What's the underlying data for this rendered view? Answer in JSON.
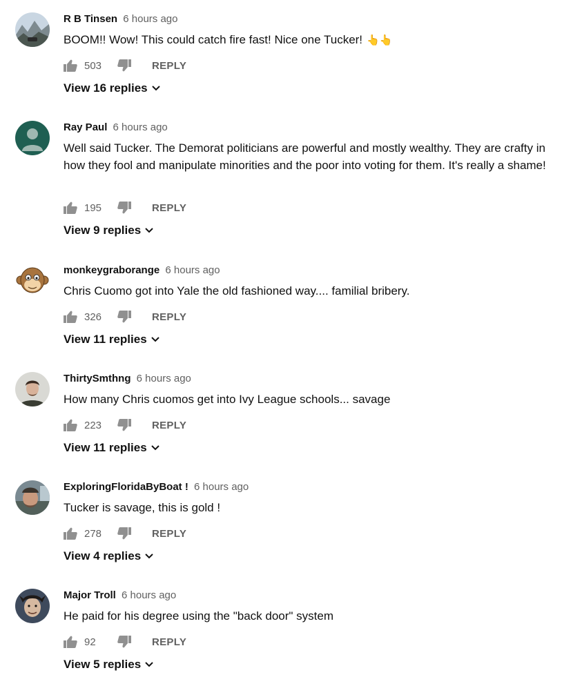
{
  "comments": [
    {
      "author": "R B Tinsen",
      "time": "6 hours ago",
      "text": "BOOM!!  Wow!  This could catch fire fast!   Nice one Tucker!",
      "emoji": "👆👆",
      "likes": "503",
      "reply_label": "REPLY",
      "view_replies": "View 16 replies",
      "avatar_icon": "mountain-landscape-avatar"
    },
    {
      "author": "Ray Paul",
      "time": "6 hours ago",
      "text": "Well said Tucker.  The Demorat politicians are powerful and mostly wealthy.  They are crafty in how they fool and manipulate minorities and the poor into voting for them.  It's really a shame!",
      "likes": "195",
      "reply_label": "REPLY",
      "view_replies": "View 9 replies",
      "avatar_icon": "default-user-avatar"
    },
    {
      "author": "monkeygraborange",
      "time": "6 hours ago",
      "text": "Chris Cuomo got into Yale the old fashioned way.... familial bribery.",
      "likes": "326",
      "reply_label": "REPLY",
      "view_replies": "View 11 replies",
      "avatar_icon": "monkey-avatar"
    },
    {
      "author": "ThirtySmthng",
      "time": "6 hours ago",
      "text": "How many Chris cuomos get into Ivy League schools... savage",
      "likes": "223",
      "reply_label": "REPLY",
      "view_replies": "View 11 replies",
      "avatar_icon": "person-photo-avatar"
    },
    {
      "author": "ExploringFloridaByBoat !",
      "time": "6 hours ago",
      "text": "Tucker is savage, this is gold !",
      "likes": "278",
      "reply_label": "REPLY",
      "view_replies": "View 4 replies",
      "avatar_icon": "person-photo-avatar"
    },
    {
      "author": "Major Troll",
      "time": "6 hours ago",
      "text": "He paid for his degree using the \"back door\" system",
      "likes": "92",
      "reply_label": "REPLY",
      "view_replies": "View 5 replies",
      "avatar_icon": "person-photo-avatar"
    }
  ],
  "colors": {
    "secondary_text": "#606060",
    "primary_text": "#111111",
    "default_avatar_bg": "#1f5f52"
  }
}
